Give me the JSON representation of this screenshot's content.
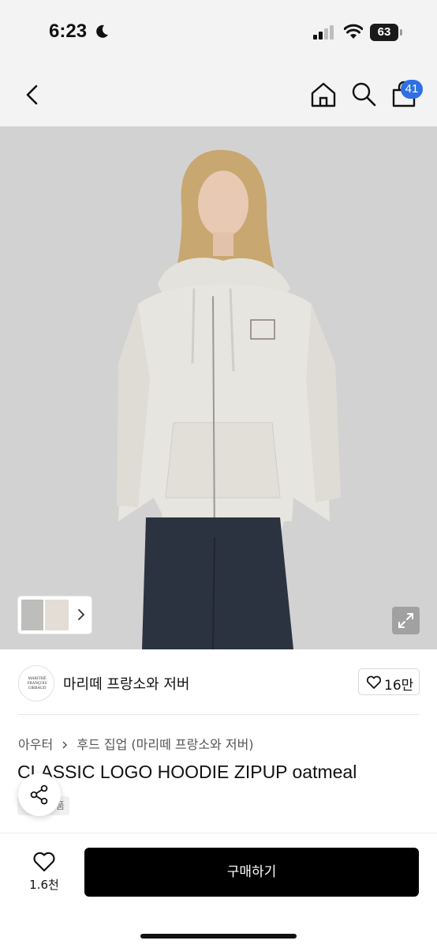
{
  "status_bar": {
    "time": "6:23",
    "battery": "63",
    "icons": [
      "moon-icon",
      "signal-icon",
      "wifi-icon",
      "battery-icon"
    ]
  },
  "nav": {
    "icons": [
      "back-icon",
      "home-icon",
      "search-icon",
      "cart-icon"
    ],
    "cart_badge": "41"
  },
  "product": {
    "image_description_icon": "expand-icon",
    "thumbnail_count_icon": "chevron-right-icon",
    "seller": {
      "name": "마리떼 프랑소와 저버",
      "logo_text": "MARITHÉ FRANÇOIS GIRBAUD",
      "like_count": "16만"
    },
    "category": {
      "level1": "아우터",
      "level2": "후드 집업 (마리떼 프랑소와 저버)"
    },
    "title": "CLASSIC LOGO HOODIE ZIPUP oatmeal",
    "tag": "품"
  },
  "bottom_bar": {
    "wish_count": "1.6천",
    "buy_label": "구매하기"
  },
  "colors": {
    "background": "#ffffff",
    "header_bg": "#f3f3f3",
    "badge": "#2f6fe4",
    "buy_button": "#000000"
  }
}
